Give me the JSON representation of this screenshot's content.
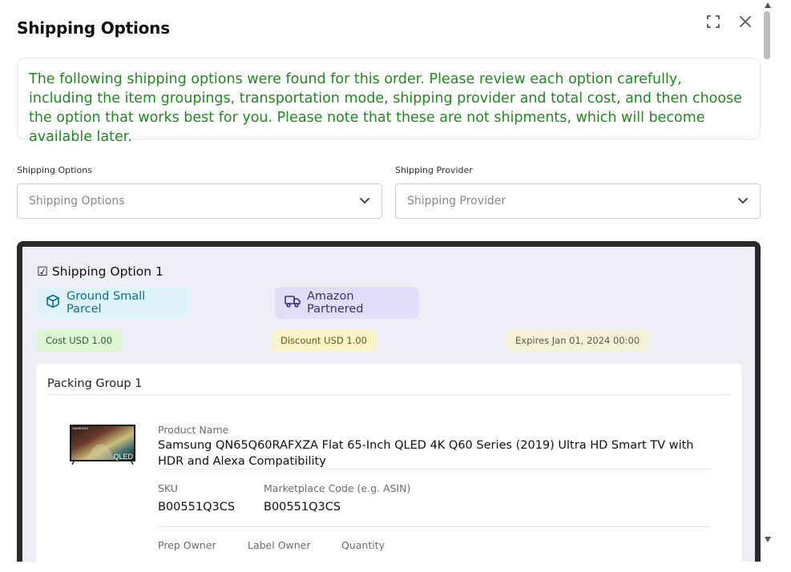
{
  "modal": {
    "title": "Shipping Options",
    "notice": "The following shipping options were found for this order. Please review each option carefully, including the item groupings, transportation mode, shipping provider and total cost, and then choose the option that works best for you. Please note that these are not shipments, which will become available later."
  },
  "filters": {
    "shipping_options": {
      "label": "Shipping Options",
      "placeholder": "Shipping Options"
    },
    "shipping_provider": {
      "label": "Shipping Provider",
      "placeholder": "Shipping Provider"
    }
  },
  "option": {
    "heading": "☑ Shipping Option 1",
    "mode": "Ground Small Parcel",
    "provider": "Amazon Partnered",
    "cost": "Cost USD 1.00",
    "discount": "Discount USD 1.00",
    "expires": "Expires Jan 01, 2024 00:00",
    "group": {
      "title": "Packing Group 1",
      "product_name_label": "Product Name",
      "product_name": "Samsung QN65Q60RAFXZA Flat 65-Inch QLED 4K Q60 Series (2019) Ultra HD Smart TV with HDR and Alexa Compatibility",
      "sku_label": "SKU",
      "sku": "B00551Q3CS",
      "marketplace_label": "Marketplace Code (e.g. ASIN)",
      "marketplace": "B00551Q3CS",
      "prep_owner_label": "Prep Owner",
      "label_owner_label": "Label Owner",
      "quantity_label": "Quantity",
      "thumb_brand": "SAMSUNG",
      "thumb_text": "QLED"
    }
  },
  "colors": {
    "notice_text": "#1f8a1f",
    "card_border": "#2a2a2a",
    "card_bg": "#eeeff6"
  },
  "icons": {
    "expand": "expand-icon",
    "close": "close-icon",
    "chevron": "chevron-down-icon",
    "box": "box-icon",
    "truck": "truck-icon"
  }
}
